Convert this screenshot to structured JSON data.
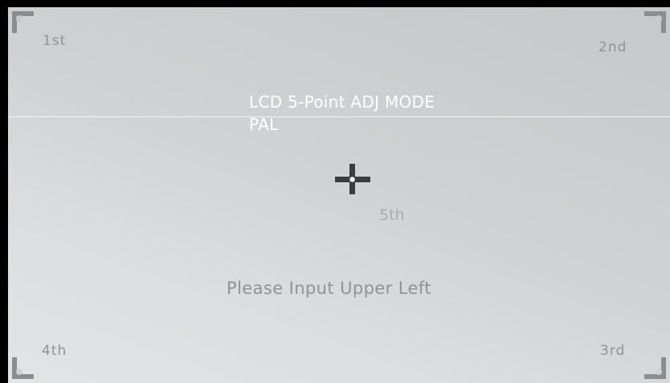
{
  "screen": {
    "mode_title": "LCD 5-Point ADJ MODE",
    "signal": "PAL",
    "instruction": "Please Input Upper Left"
  },
  "points": {
    "first": "1st",
    "second": "2nd",
    "third": "3rd",
    "fourth": "4th",
    "fifth": "5th"
  },
  "colors": {
    "marker": "#8a8d8f",
    "crosshair": "#3a3c3e",
    "title_text": "#ffffff",
    "label_text": "#8f9395"
  }
}
